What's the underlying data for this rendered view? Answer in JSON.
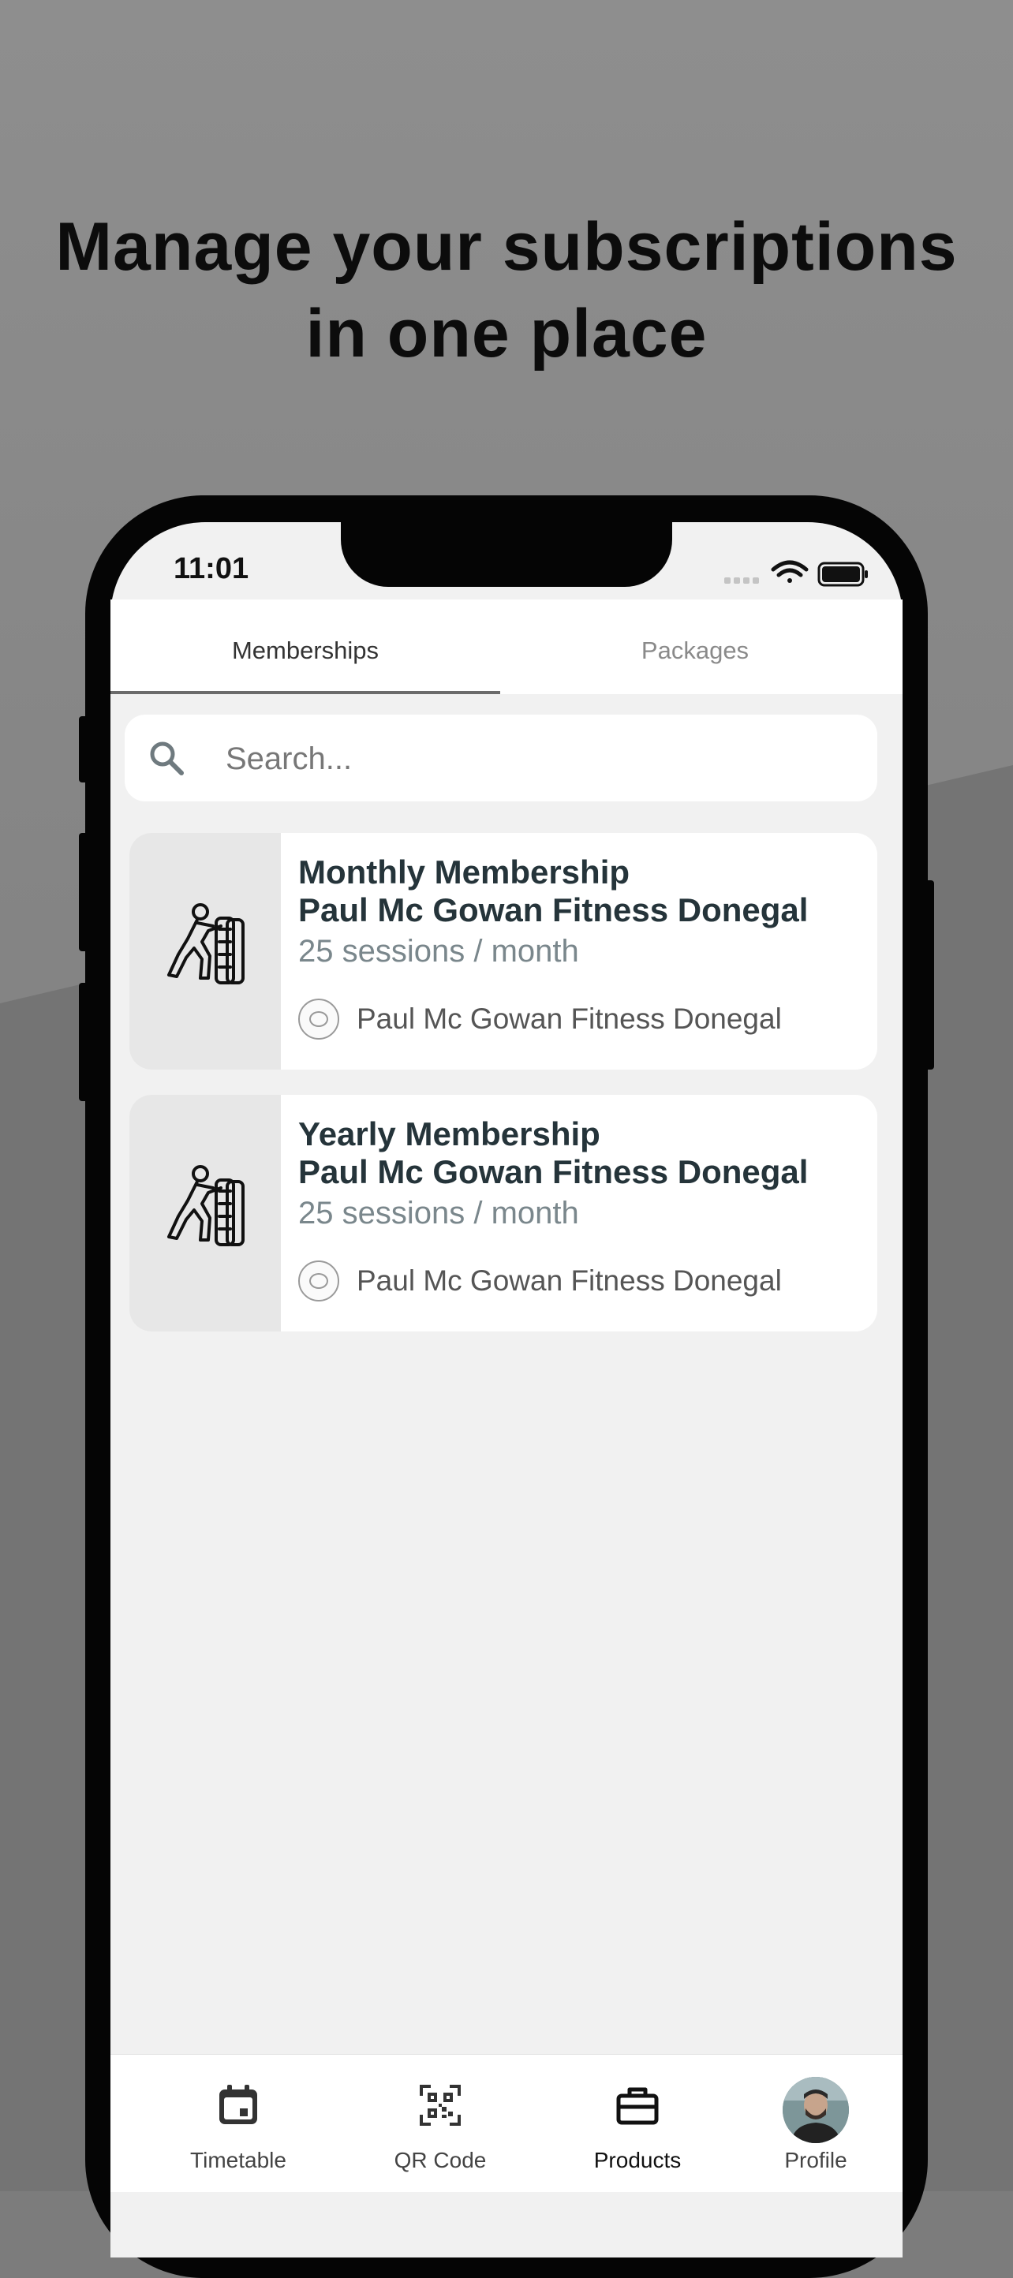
{
  "headline": {
    "line1": "Manage your subscriptions",
    "line2": "in one place"
  },
  "status_bar": {
    "time": "11:01"
  },
  "tabs": [
    {
      "label": "Memberships",
      "active": true
    },
    {
      "label": "Packages",
      "active": false
    }
  ],
  "search": {
    "placeholder": "Search...",
    "value": ""
  },
  "memberships": [
    {
      "title_line1": "Monthly Membership",
      "title_line2": "Paul Mc Gowan Fitness Donegal",
      "sessions": "25 sessions / month",
      "gym": "Paul Mc Gowan Fitness Donegal",
      "icon": "tire-flip-icon"
    },
    {
      "title_line1": "Yearly Membership",
      "title_line2": "Paul Mc Gowan Fitness Donegal",
      "sessions": "25 sessions / month",
      "gym": "Paul Mc Gowan Fitness Donegal",
      "icon": "tire-flip-icon"
    }
  ],
  "bottom_nav": [
    {
      "label": "Timetable",
      "icon": "calendar-icon"
    },
    {
      "label": "QR Code",
      "icon": "qr-code-icon"
    },
    {
      "label": "Products",
      "icon": "briefcase-icon",
      "active": true
    },
    {
      "label": "Profile",
      "icon": "avatar"
    }
  ],
  "colors": {
    "background": "#7c7c7c",
    "title_text": "#25343a",
    "muted_text": "#7a878c",
    "tab_indicator": "#6b6b6b"
  }
}
